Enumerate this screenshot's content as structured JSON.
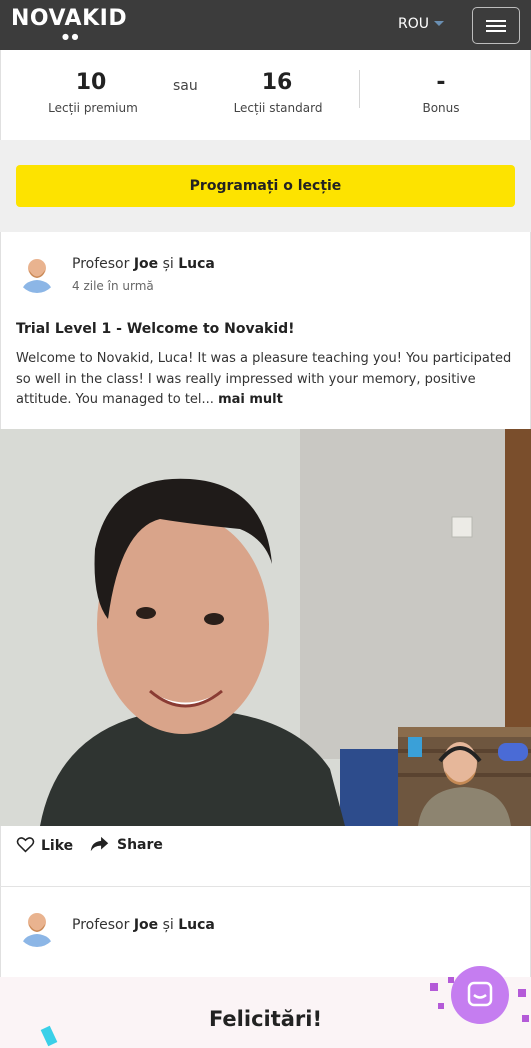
{
  "header": {
    "logo_text": "NOVAKID",
    "language": "ROU"
  },
  "stats": {
    "premium": {
      "value": "10",
      "label": "Lecții premium"
    },
    "separator": "sau",
    "standard": {
      "value": "16",
      "label": "Lecții standard"
    },
    "bonus": {
      "value": "-",
      "label": "Bonus"
    }
  },
  "cta_label": "Programați o lecție",
  "post": {
    "teacher_prefix": "Profesor",
    "teacher_name": "Joe",
    "conjunction": "și",
    "student_name": "Luca",
    "time_ago": "4 zile în urmă",
    "title": "Trial Level 1 - Welcome to Novakid!",
    "body": "Welcome to Novakid, Luca! It was a pleasure teaching you! You participated so well in the class! I was really impressed with your memory, positive attitude. You managed to tel...",
    "more_label": "mai mult",
    "like_label": "Like",
    "share_label": "Share"
  },
  "post2": {
    "teacher_prefix": "Profesor",
    "teacher_name": "Joe",
    "conjunction": "și",
    "student_name": "Luca",
    "congrats": "Felicitări!"
  },
  "colors": {
    "header_bg": "#3c3c3c",
    "cta_yellow": "#fde300",
    "chat_purple": "#c57df0"
  },
  "icons": [
    "menu-icon",
    "heart-icon",
    "share-icon",
    "chat-icon",
    "caret-down-icon"
  ]
}
